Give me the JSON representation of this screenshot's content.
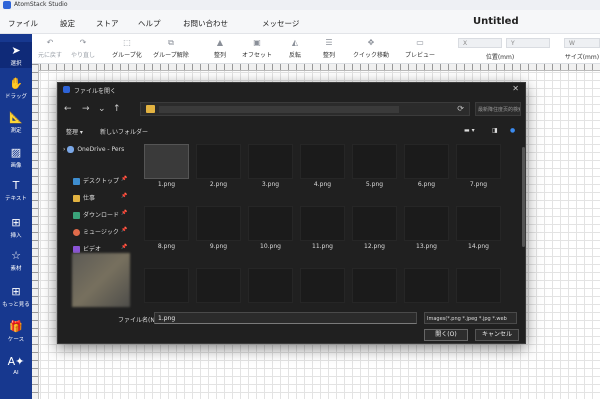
{
  "app_title": "AtomStack Studio",
  "menu": [
    "ファイル",
    "設定",
    "ストア",
    "ヘルプ",
    "お問い合わせ",
    "メッセージ"
  ],
  "document_title": "Untitled",
  "toolbar": {
    "undo": "元に戻す",
    "redo": "やり直し",
    "group": "グループ化",
    "ungroup": "グループ解除",
    "arrange": "整列",
    "offset": "オフセット",
    "flip": "反転",
    "align": "整列",
    "quick_move": "クイック移動",
    "preview": "プレビュー",
    "position": "位置(mm)",
    "size": "サイズ(mm)",
    "x": "X",
    "y": "Y",
    "w": "W"
  },
  "sidebar": [
    "選択",
    "ドラッグ",
    "測定",
    "画像",
    "テキスト",
    "挿入",
    "素材",
    "もっと見る",
    "ケース",
    "AI"
  ],
  "dialog": {
    "title": "ファイルを開く",
    "search_placeholder": "最新降住度页的検索",
    "organize": "整理 ▾",
    "new_folder": "新しいフォルダー",
    "nav": {
      "onedrive": "OneDrive - Pers",
      "items": [
        "デスクトップ",
        "仕事",
        "ダウンロード",
        "ミュージック",
        "ビデオ"
      ]
    },
    "files": [
      "1.png",
      "2.png",
      "3.png",
      "4.png",
      "5.png",
      "6.png",
      "7.png",
      "8.png",
      "9.png",
      "10.png",
      "11.png",
      "12.png",
      "13.png",
      "14.png"
    ],
    "filename_label": "ファイル名(N):",
    "filename_value": "1.png",
    "filetype": "Images(*.png *.jpeg *.jpg *.web",
    "open": "開く(O)",
    "cancel": "キャンセル"
  },
  "colors": {
    "sidebar": "#17388f",
    "dialog_bg": "#202020",
    "accent": "#2d63d8"
  }
}
